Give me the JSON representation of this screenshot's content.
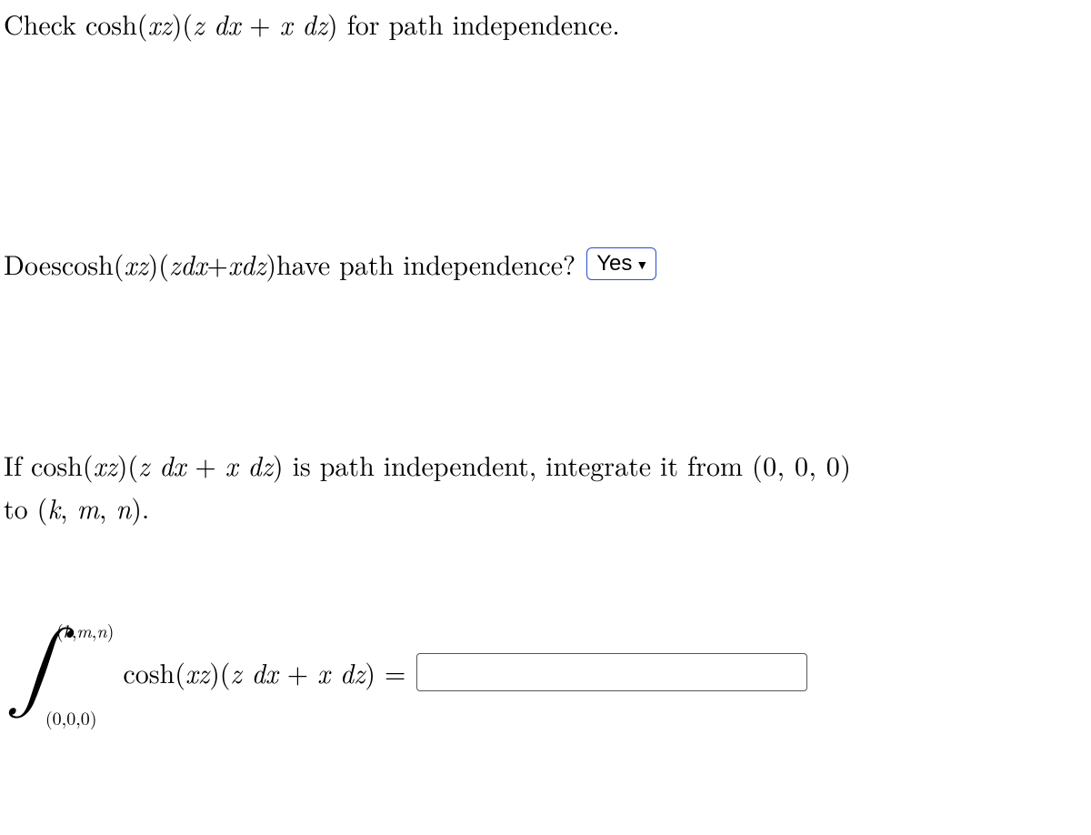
{
  "prompt": {
    "check_prefix": "Check ",
    "expr_cosh": "cosh(",
    "expr_xz": "xz",
    "expr_close_open": ")(",
    "expr_z": "z",
    "expr_dx": " dx",
    "expr_plus": " + ",
    "expr_x": "x",
    "expr_dz": " dz",
    "expr_close": ")",
    "check_suffix": " for path independence."
  },
  "question": {
    "prefix": "Does ",
    "suffix": " have path independence?",
    "dropdown_value": "Yes"
  },
  "instruction": {
    "prefix": "If ",
    "mid": " is path independent, integrate it from ",
    "from_pt": "(0, 0, 0)",
    "to_word": "to ",
    "to_pt_open": "(",
    "to_pt_k": "k",
    "to_pt_c1": ", ",
    "to_pt_m": "m",
    "to_pt_c2": ", ",
    "to_pt_n": "n",
    "to_pt_close": ").",
    "newline_join": " "
  },
  "integral": {
    "upper_open": "(",
    "upper_k": "k",
    "upper_c1": ",",
    "upper_m": "m",
    "upper_c2": ",",
    "upper_n": "n",
    "upper_close": ")",
    "lower": "(0,0,0)",
    "equals": "=",
    "answer_value": ""
  }
}
